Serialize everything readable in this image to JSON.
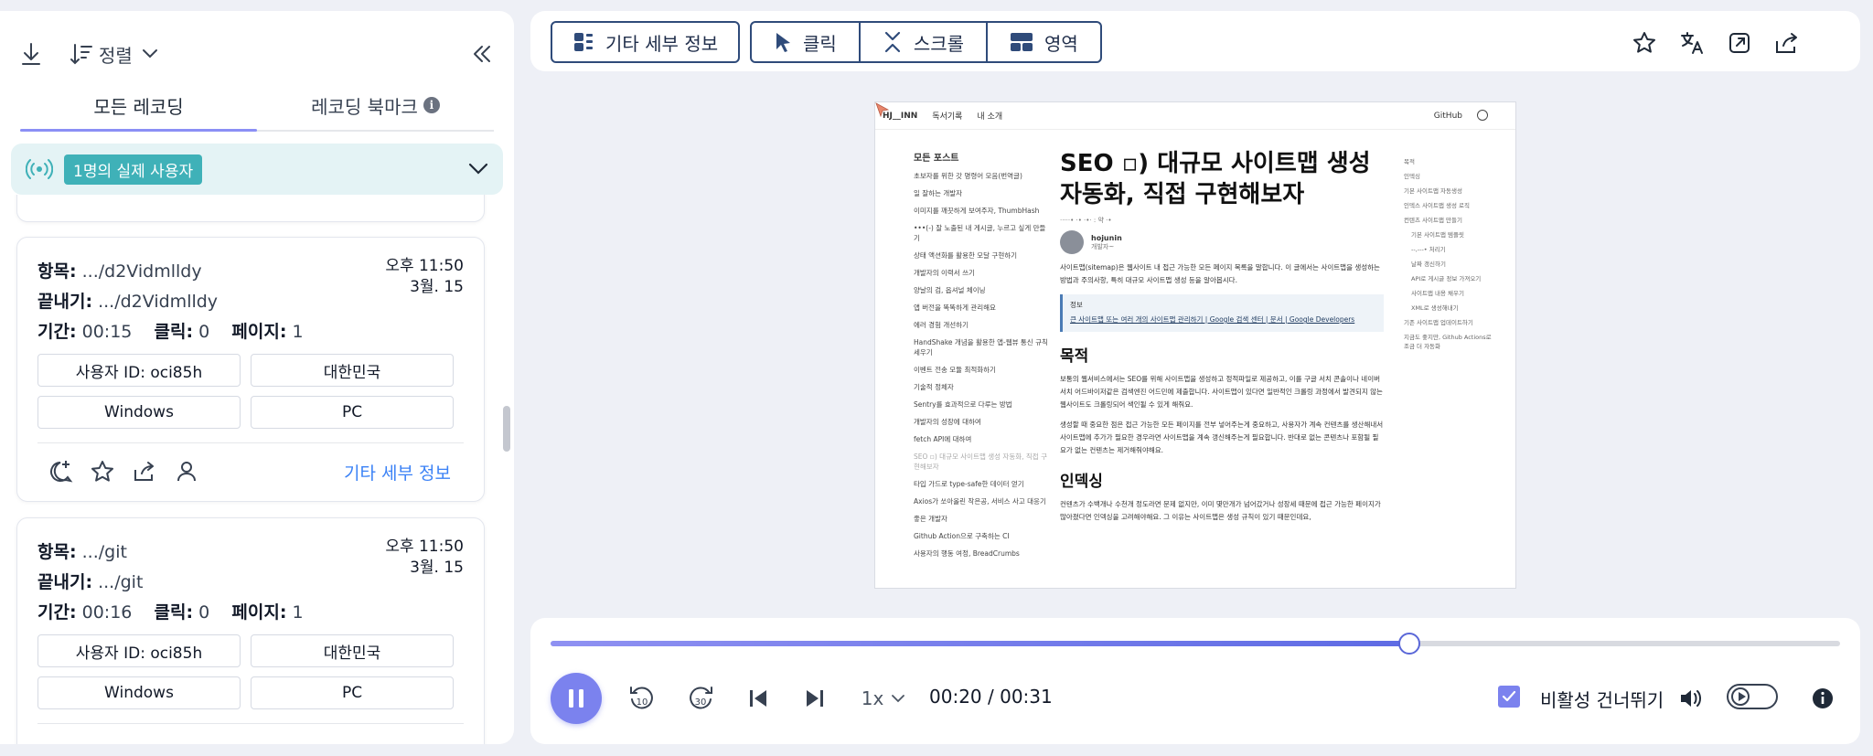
{
  "sidebar": {
    "sort_label": "정렬",
    "tabs": [
      {
        "label": "모든 레코딩"
      },
      {
        "label": "레코딩 북마크"
      }
    ],
    "live_badge": "1명의 실제 사용자",
    "recordings": [
      {
        "entry_label": "항목:",
        "entry": ".../d2Vidmlldy",
        "exit_label": "끝내기:",
        "exit": ".../d2Vidmlldy",
        "duration_label": "기간:",
        "duration": "00:15",
        "clicks_label": "클릭:",
        "clicks": "0",
        "pages_label": "페이지:",
        "pages": "1",
        "time": "오후 11:50",
        "date": "3월. 15",
        "user_id": "사용자 ID: oci85h",
        "country": "대한민국",
        "os": "Windows",
        "device": "PC",
        "more": "기타 세부 정보"
      },
      {
        "entry_label": "항목:",
        "entry": ".../git",
        "exit_label": "끝내기:",
        "exit": ".../git",
        "duration_label": "기간:",
        "duration": "00:16",
        "clicks_label": "클릭:",
        "clicks": "0",
        "pages_label": "페이지:",
        "pages": "1",
        "time": "오후 11:50",
        "date": "3월. 15",
        "user_id": "사용자 ID: oci85h",
        "country": "대한민국",
        "os": "Windows",
        "device": "PC",
        "more": "기타 세부 정보"
      }
    ]
  },
  "toolbar": {
    "details_label": "기타 세부 정보",
    "click_label": "클릭",
    "scroll_label": "스크롤",
    "area_label": "영역"
  },
  "preview": {
    "nav": {
      "logo": "HJ__INN",
      "reading": "독서기록",
      "about": "내 소개",
      "github": "GitHub"
    },
    "sidebar_heading": "모든 포스트",
    "posts": [
      "초보자를 위한 갓 명령어 모음(번역글)",
      "일 잘하는 개발자",
      "이미지를 깨끗하게 보여주자, ThumbHash",
      "•••(-) 잘 노출된 내 게시글, 누르고 싶게 만들기",
      "상태 액션화를 활용한 모달 구현하기",
      "개발자의 이력서 쓰기",
      "양날의 검, 옵셔널 체이닝",
      "앱 버전을 똑똑하게 관리해요",
      "에러 경험 개선하기",
      "HandShake 개념을 활용한 앱-웹뷰 통신 규칙 세우기",
      "이벤트 전송 모듈 최적화하기",
      "기술적 정체자",
      "Sentry를 효과적으로 다루는 방법",
      "개발자의 성장에 대하여",
      "fetch API에 대하여",
      "SEO ▫) 대규모 사이트맵 생성 자동화, 직접 구현해보자",
      "타입 가드로 type-safe한 데이터 얻기",
      "Axios가 쏘아올린 작은공, 서비스 사고 대응기",
      "좋은 개발자",
      "Github Action으로 구축하는 CI",
      "사용자의 행동 여정, BreadCrumbs"
    ],
    "title": "SEO ▫) 대규모 사이트맵 생성 자동화, 직접 구현해보자",
    "meta": "·····• ·• ·•· : 약 ·•",
    "author_name": "hojunin",
    "author_role": "개발자~",
    "intro": "사이트맵(sitemap)은 웹사이트 내 접근 가능한 모든 페이지 목록을 말합니다. 이 글에서는 사이트맵을 생성하는 방법과 주의사항, 특히 대규모 사이트맵 생성 등을 알아봅시다.",
    "note_title": "정보",
    "note_link": "큰 사이트맵 또는 여러 개의 사이트맵 관리하기 | Google 검색 센터 | 문서 | Google Developers",
    "h_purpose": "목적",
    "p1": "보통의 웹서비스에서는 SEO를 위해 사이트맵을 생성하고 정적파일로 제공하고, 이를 구글 서치 콘솔이나 네이버 서치 어드바이저같은 검색엔진 어드민에 제출합니다. 사이트맵이 있다면 일반적인 크롤링 과정에서 발견되지 않는 웹사이트도 크롤링되어 색인될 수 있게 해줘요.",
    "p2": "생성할 때 중요한 점은 접근 가능한 모든 페이지를 전부 넣어주는게 중요하고, 사용자가 계속 컨텐츠를 생산해내서 사이트맵에 추가가 필요한 경우라면 사이트맵을 계속 갱신해주는게 필요합니다. 반대로 없는 콘텐츠나 포함될 필요가 없는 컨텐츠는 제거해줘야해요.",
    "h_index": "인덱싱",
    "p3": "컨텐츠가 수백개나 수천개 정도라면 문제 없지만, 이미 몇만개가 넘어갔거나 성장세 때문에 접근 가능한 페이지가 많아졌다면 인덱싱을 고려해야해요. 그 이유는 사이트맵은 생성 규칙이 있기 때문인데요,",
    "toc": [
      {
        "label": "목적",
        "sub": false
      },
      {
        "label": "인덱싱",
        "sub": false
      },
      {
        "label": "기본 사이트맵 자동생성",
        "sub": false
      },
      {
        "label": "인덱스 사이트맵 생성 로직",
        "sub": false
      },
      {
        "label": "컨텐츠 사이트맵 만들기",
        "sub": false
      },
      {
        "label": "기본 사이트맵 템플릿",
        "sub": true
      },
      {
        "label": "--,---• 처리기",
        "sub": true
      },
      {
        "label": "날짜 갱신하기",
        "sub": true
      },
      {
        "label": "API로 게시글 정보 가져오기",
        "sub": true
      },
      {
        "label": "사이트맵 내용 채우기",
        "sub": true
      },
      {
        "label": "XML로 생성해내기",
        "sub": true
      },
      {
        "label": "기존 사이트맵 업데이트하기",
        "sub": false
      },
      {
        "label": "지금도 좋지만, Github Actions로 조금 더 자동화",
        "sub": false
      }
    ]
  },
  "player": {
    "progress": 0.666,
    "speed": "1x",
    "time": "00:20 / 00:31",
    "skip_label": "비활성 건너뛰기",
    "skip_checked": true,
    "accent": "#7b82ee"
  }
}
